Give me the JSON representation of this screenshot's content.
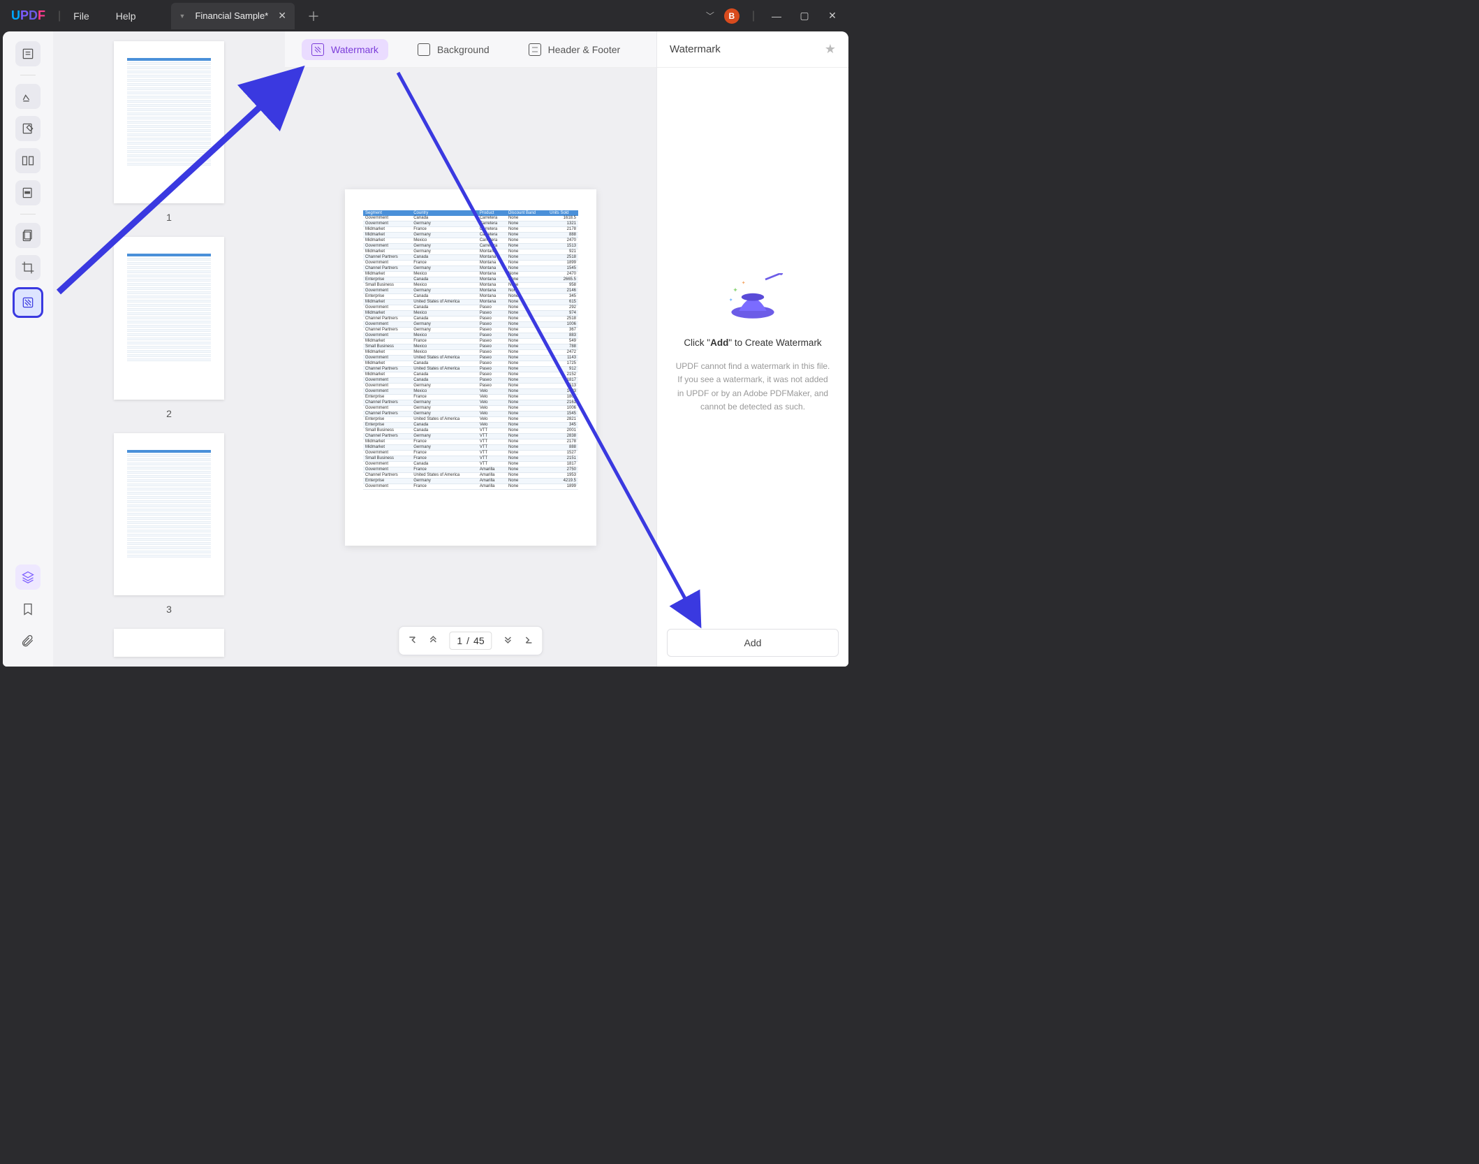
{
  "app": {
    "logo": "UPDF"
  },
  "menu": {
    "file": "File",
    "help": "Help"
  },
  "tab": {
    "name": "Financial Sample*",
    "user_initial": "B"
  },
  "subtabs": {
    "watermark": "Watermark",
    "background": "Background",
    "header_footer": "Header & Footer"
  },
  "right_panel": {
    "title": "Watermark",
    "msg_pre": "Click \"",
    "msg_bold": "Add",
    "msg_post": "\" to Create Watermark",
    "sub": "UPDF cannot find a watermark in this file. If you see a watermark, it was not added in UPDF or by an Adobe PDFMaker, and cannot be detected as such.",
    "add_label": "Add"
  },
  "pager": {
    "current": "1",
    "sep": "/",
    "total": "45"
  },
  "thumbs": {
    "1": "1",
    "2": "2",
    "3": "3"
  },
  "doc": {
    "headers": [
      "Segment",
      "Country",
      "Product",
      "Discount Band",
      "Units Sold"
    ],
    "rows": [
      [
        "Government",
        "Canada",
        "Carretera",
        "None",
        "1618.5"
      ],
      [
        "Government",
        "Germany",
        "Carretera",
        "None",
        "1321"
      ],
      [
        "Midmarket",
        "France",
        "Carretera",
        "None",
        "2178"
      ],
      [
        "Midmarket",
        "Germany",
        "Carretera",
        "None",
        "888"
      ],
      [
        "Midmarket",
        "Mexico",
        "Carretera",
        "None",
        "2470"
      ],
      [
        "Government",
        "Germany",
        "Carretera",
        "None",
        "1513"
      ],
      [
        "Midmarket",
        "Germany",
        "Montana",
        "None",
        "921"
      ],
      [
        "Channel Partners",
        "Canada",
        "Montana",
        "None",
        "2518"
      ],
      [
        "Government",
        "France",
        "Montana",
        "None",
        "1899"
      ],
      [
        "Channel Partners",
        "Germany",
        "Montana",
        "None",
        "1545"
      ],
      [
        "Midmarket",
        "Mexico",
        "Montana",
        "None",
        "2470"
      ],
      [
        "Enterprise",
        "Canada",
        "Montana",
        "None",
        "2665.5"
      ],
      [
        "Small Business",
        "Mexico",
        "Montana",
        "None",
        "958"
      ],
      [
        "Government",
        "Germany",
        "Montana",
        "None",
        "2146"
      ],
      [
        "Enterprise",
        "Canada",
        "Montana",
        "None",
        "345"
      ],
      [
        "Midmarket",
        "United States of America",
        "Montana",
        "None",
        "615"
      ],
      [
        "Government",
        "Canada",
        "Paseo",
        "None",
        "292"
      ],
      [
        "Midmarket",
        "Mexico",
        "Paseo",
        "None",
        "974"
      ],
      [
        "Channel Partners",
        "Canada",
        "Paseo",
        "None",
        "2518"
      ],
      [
        "Government",
        "Germany",
        "Paseo",
        "None",
        "1006"
      ],
      [
        "Channel Partners",
        "Germany",
        "Paseo",
        "None",
        "367"
      ],
      [
        "Government",
        "Mexico",
        "Paseo",
        "None",
        "883"
      ],
      [
        "Midmarket",
        "France",
        "Paseo",
        "None",
        "549"
      ],
      [
        "Small Business",
        "Mexico",
        "Paseo",
        "None",
        "788"
      ],
      [
        "Midmarket",
        "Mexico",
        "Paseo",
        "None",
        "2472"
      ],
      [
        "Government",
        "United States of America",
        "Paseo",
        "None",
        "1143"
      ],
      [
        "Midmarket",
        "Canada",
        "Paseo",
        "None",
        "1725"
      ],
      [
        "Channel Partners",
        "United States of America",
        "Paseo",
        "None",
        "912"
      ],
      [
        "Midmarket",
        "Canada",
        "Paseo",
        "None",
        "2152"
      ],
      [
        "Government",
        "Canada",
        "Paseo",
        "None",
        "1817"
      ],
      [
        "Government",
        "Germany",
        "Paseo",
        "None",
        "1513"
      ],
      [
        "Government",
        "Mexico",
        "Velo",
        "None",
        "1493"
      ],
      [
        "Enterprise",
        "France",
        "Velo",
        "None",
        "1804"
      ],
      [
        "Channel Partners",
        "Germany",
        "Velo",
        "None",
        "2161"
      ],
      [
        "Government",
        "Germany",
        "Velo",
        "None",
        "1006"
      ],
      [
        "Channel Partners",
        "Germany",
        "Velo",
        "None",
        "1545"
      ],
      [
        "Enterprise",
        "United States of America",
        "Velo",
        "None",
        "2821"
      ],
      [
        "Enterprise",
        "Canada",
        "Velo",
        "None",
        "345"
      ],
      [
        "Small Business",
        "Canada",
        "VTT",
        "None",
        "2001"
      ],
      [
        "Channel Partners",
        "Germany",
        "VTT",
        "None",
        "2838"
      ],
      [
        "Midmarket",
        "France",
        "VTT",
        "None",
        "2178"
      ],
      [
        "Midmarket",
        "Germany",
        "VTT",
        "None",
        "888"
      ],
      [
        "Government",
        "France",
        "VTT",
        "None",
        "1527"
      ],
      [
        "Small Business",
        "France",
        "VTT",
        "None",
        "2151"
      ],
      [
        "Government",
        "Canada",
        "VTT",
        "None",
        "1817"
      ],
      [
        "Government",
        "France",
        "Amarilla",
        "None",
        "2750"
      ],
      [
        "Channel Partners",
        "United States of America",
        "Amarilla",
        "None",
        "1953"
      ],
      [
        "Enterprise",
        "Germany",
        "Amarilla",
        "None",
        "4219.5"
      ],
      [
        "Government",
        "France",
        "Amarilla",
        "None",
        "1899"
      ]
    ]
  }
}
